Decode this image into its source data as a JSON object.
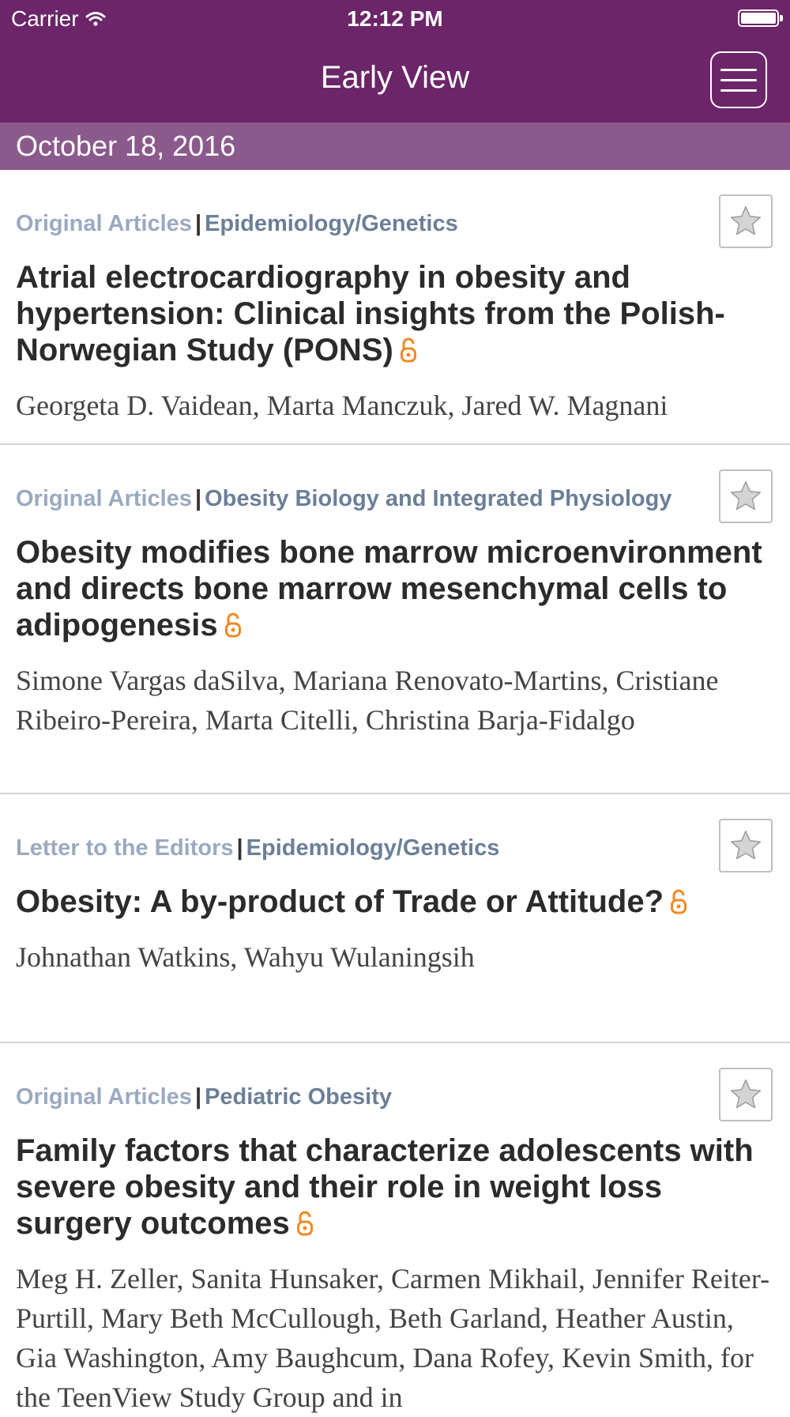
{
  "status_bar": {
    "carrier": "Carrier",
    "time": "12:12 PM"
  },
  "nav": {
    "title": "Early View"
  },
  "date_header": "October 18, 2016",
  "colors": {
    "nav_background": "#6b2568",
    "date_bar_background": "#8b5a8c",
    "open_access_icon": "#f08a24"
  },
  "articles": [
    {
      "type": "Original Articles",
      "separator": "|",
      "category": "Epidemiology/Genetics",
      "title": "Atrial electrocardiography in obesity and hypertension: Clinical insights from the Polish-Norwegian Study (PONS)",
      "authors": "Georgeta D. Vaidean, Marta Manczuk, Jared W. Magnani"
    },
    {
      "type": "Original Articles",
      "separator": "|",
      "category": "Obesity Biology and Integrated Physiology",
      "title": "Obesity modifies bone marrow microenvironment and directs bone marrow mesenchymal cells to adipogenesis",
      "authors": "Simone Vargas daSilva, Mariana Renovato-Martins, Cristiane Ribeiro-Pereira, Marta Citelli, Christina Barja-Fidalgo"
    },
    {
      "type": "Letter to the Editors",
      "separator": "|",
      "category": "Epidemiology/Genetics",
      "title": "Obesity: A by-product of Trade or Attitude?",
      "authors": "Johnathan Watkins, Wahyu Wulaningsih"
    },
    {
      "type": "Original Articles",
      "separator": "|",
      "category": "Pediatric Obesity",
      "title": "Family factors that characterize adolescents with severe obesity and their role in weight loss surgery outcomes",
      "authors": "Meg H. Zeller, Sanita Hunsaker, Carmen Mikhail, Jennifer Reiter-Purtill, Mary Beth McCullough, Beth Garland, Heather Austin, Gia Washington, Amy Baughcum, Dana Rofey, Kevin Smith, for the TeenView Study Group and in"
    }
  ]
}
